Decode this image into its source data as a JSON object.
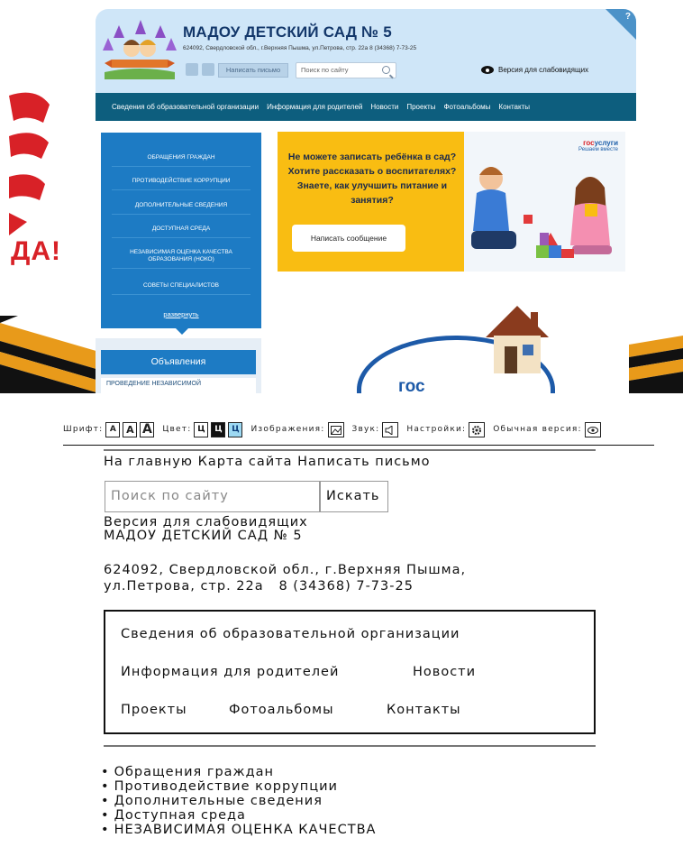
{
  "normal": {
    "title": "МАДОУ ДЕТСКИЙ САД № 5",
    "address": "624092, Свердловской обл., г.Верхняя Пышма, ул.Петрова, стр. 22а     8 (34368) 7-73-25",
    "write_label": "Написать письмо",
    "search_placeholder": "Поиск по сайту",
    "vision_label": "Версия для слабовидящих",
    "help": "?",
    "deco_text": "ДА!",
    "nav": [
      "Сведения об образовательной организации",
      "Информация для родителей",
      "Новости",
      "Проекты",
      "Фотоальбомы",
      "Контакты"
    ],
    "side_menu": [
      "Обращения граждан",
      "Противодействие коррупции",
      "Дополнительные сведения",
      "Доступная среда",
      "Независимая оценка качества образования (НОКО)",
      "Советы специалистов"
    ],
    "side_expand": "развернуть",
    "ads_title": "Объявления",
    "ads_item": "Проведение независимой",
    "promo_text": "Не можете записать ребёнка в сад? Хотите рассказать о воспитателях? Знаете, как улучшить питание и занятия?",
    "promo_button": "Написать сообщение",
    "gos_brand_a": "гос",
    "gos_brand_b": "услуги",
    "gos_tagline": "Решаем вместе",
    "house_word": "гос"
  },
  "accessible": {
    "toolbar": {
      "font_label": "Шрифт:",
      "font_sizes": [
        "А",
        "А",
        "А"
      ],
      "color_label": "Цвет:",
      "colors": [
        "Ц",
        "Ц",
        "Ц"
      ],
      "images_label": "Изображения:",
      "sound_label": "Звук:",
      "settings_label": "Настройки:",
      "normal_label": "Обычная версия:"
    },
    "top_links": "На главную Карта сайта Написать письмо",
    "search_placeholder": "Поиск по сайту",
    "search_button": "Искать",
    "vision_label": "Версия для слабовидящих",
    "title": "МАДОУ ДЕТСКИЙ САД № 5",
    "address_line1": "624092, Свердловской обл., г.Верхняя Пышма,",
    "address_line2": "ул.Петрова, стр. 22а   8 (34368) 7-73-25",
    "nav": [
      "Сведения об образовательной организации",
      "Информация для родителей",
      "Новости",
      "Проекты",
      "Фотоальбомы",
      "Контакты"
    ],
    "list": [
      "Обращения граждан",
      "Противодействие коррупции",
      "Дополнительные сведения",
      "Доступная среда",
      "НЕЗАВИСИМАЯ ОЦЕНКА КАЧЕСТВА"
    ]
  }
}
